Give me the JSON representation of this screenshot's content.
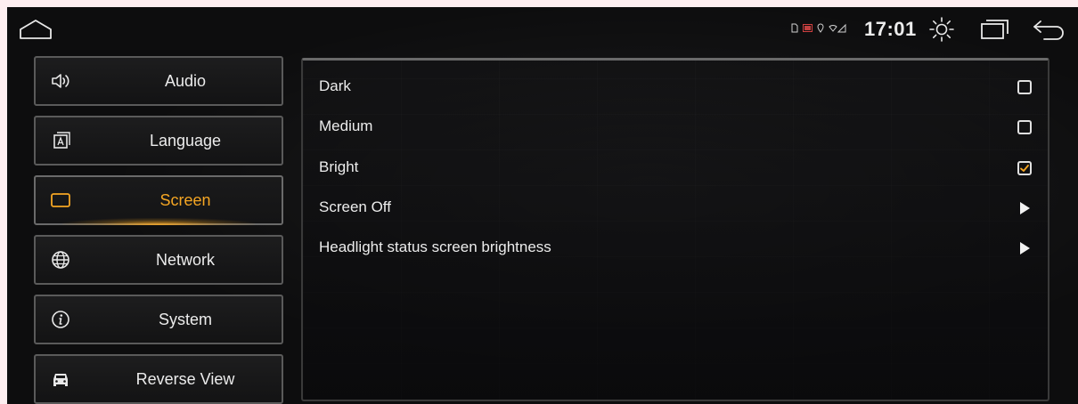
{
  "status_bar": {
    "time": "17:01",
    "indicator_icons": [
      "sd-card-icon",
      "cast-icon",
      "location-icon",
      "wifi-signal-icon"
    ]
  },
  "sidebar": {
    "items": [
      {
        "label": "Audio",
        "icon": "speaker-icon",
        "active": false
      },
      {
        "label": "Language",
        "icon": "language-icon",
        "active": false
      },
      {
        "label": "Screen",
        "icon": "screen-icon",
        "active": true
      },
      {
        "label": "Network",
        "icon": "globe-icon",
        "active": false
      },
      {
        "label": "System",
        "icon": "info-icon",
        "active": false
      },
      {
        "label": "Reverse View",
        "icon": "car-icon",
        "active": false
      }
    ]
  },
  "settings": {
    "rows": [
      {
        "label": "Dark",
        "control": "checkbox",
        "checked": false
      },
      {
        "label": "Medium",
        "control": "checkbox",
        "checked": false
      },
      {
        "label": "Bright",
        "control": "checkbox",
        "checked": true
      },
      {
        "label": "Screen Off",
        "control": "arrow"
      },
      {
        "label": "Headlight status screen brightness",
        "control": "arrow"
      }
    ]
  },
  "colors": {
    "accent": "#f5a623",
    "background": "#0d0d0e",
    "text": "#ececec"
  }
}
